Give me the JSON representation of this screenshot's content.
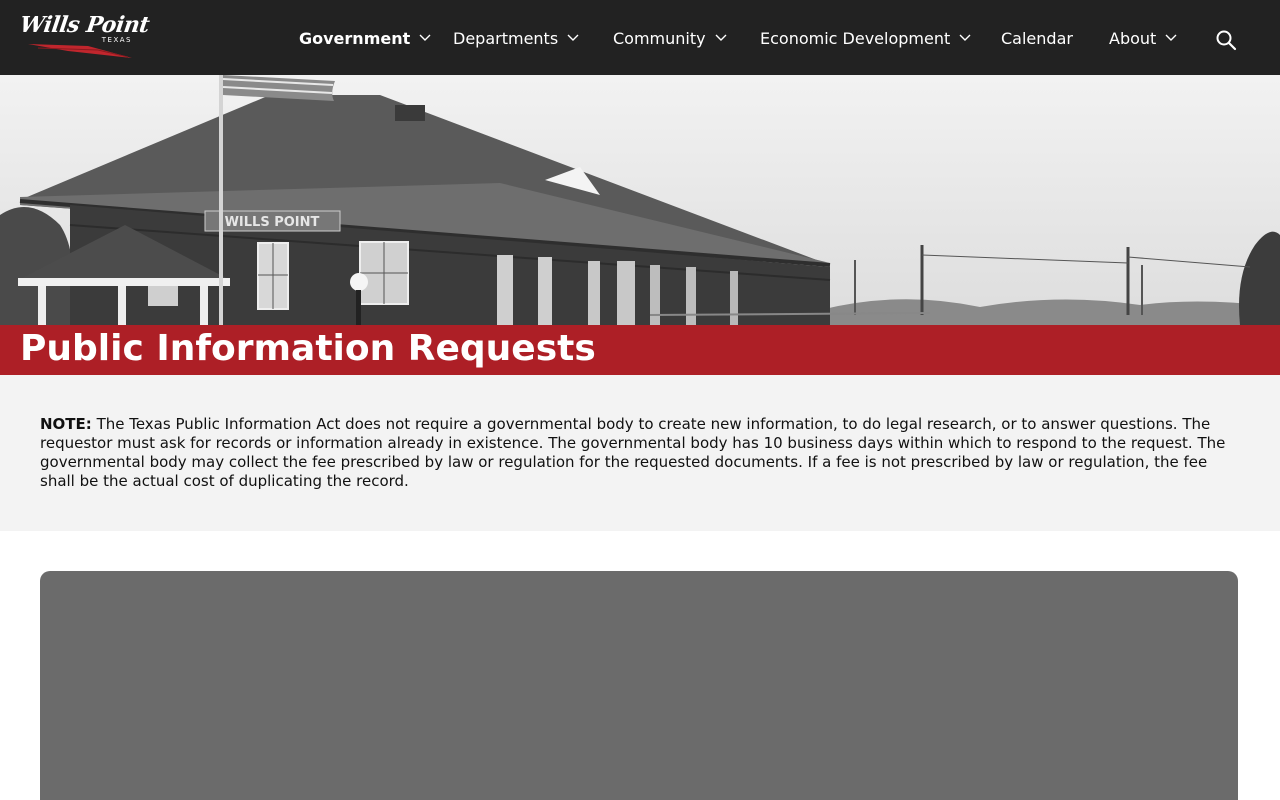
{
  "header": {
    "logo_text": "Wills Point",
    "logo_subtext": "TEXAS",
    "nav": [
      {
        "label": "Government",
        "has_dropdown": true,
        "active": true
      },
      {
        "label": "Departments",
        "has_dropdown": true,
        "active": false
      },
      {
        "label": "Community",
        "has_dropdown": true,
        "active": false
      },
      {
        "label": "Economic Development",
        "has_dropdown": true,
        "active": false
      },
      {
        "label": "Calendar",
        "has_dropdown": false,
        "active": false
      },
      {
        "label": "About",
        "has_dropdown": true,
        "active": false
      }
    ],
    "search_icon": "search-icon"
  },
  "hero": {
    "sign_text": "WILLS POINT",
    "title": "Public Information Requests"
  },
  "note": {
    "label": "NOTE:",
    "text": " The Texas Public Information Act does not require a governmental body to create new information, to do legal research, or to answer questions. The requestor must ask for records or information already in existence. The governmental body has 10 business days within which to respond to the request. The governmental body may collect the fee prescribed by law or regulation for the requested documents. If a fee is not prescribed by law or regulation, the fee shall be the actual cost of duplicating the record."
  },
  "colors": {
    "header_bg": "#222222",
    "accent_red": "#ad1f26",
    "note_bg": "#f3f3f3",
    "embed_bg": "#6b6b6b"
  }
}
